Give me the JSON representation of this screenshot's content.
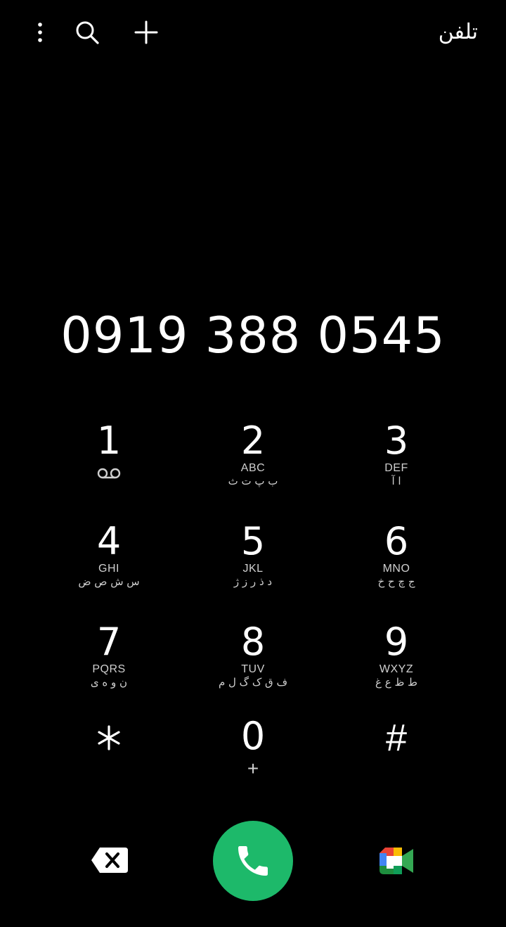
{
  "header": {
    "title": "تلفن",
    "icons": [
      "more-vert-icon",
      "search-icon",
      "add-icon"
    ]
  },
  "dialer": {
    "number": "0919 388 0545"
  },
  "keypad": {
    "keys": [
      {
        "digit": "1",
        "latin": "",
        "farsi": "",
        "extra_icon": "voicemail-icon"
      },
      {
        "digit": "2",
        "latin": "ABC",
        "farsi": "ب پ ت ث"
      },
      {
        "digit": "3",
        "latin": "DEF",
        "farsi": "ا آ"
      },
      {
        "digit": "4",
        "latin": "GHI",
        "farsi": "س ش ص ض"
      },
      {
        "digit": "5",
        "latin": "JKL",
        "farsi": "د ذ ر ز ژ"
      },
      {
        "digit": "6",
        "latin": "MNO",
        "farsi": "ج چ ح خ"
      },
      {
        "digit": "7",
        "latin": "PQRS",
        "farsi": "ن و ه ی"
      },
      {
        "digit": "8",
        "latin": "TUV",
        "farsi": "ف ق ک گ ل م"
      },
      {
        "digit": "9",
        "latin": "WXYZ",
        "farsi": "ط ظ ع غ"
      },
      {
        "digit": "*",
        "latin": "",
        "farsi": ""
      },
      {
        "digit": "0",
        "latin": "+",
        "farsi": ""
      },
      {
        "digit": "#",
        "latin": "",
        "farsi": ""
      }
    ]
  },
  "actions": {
    "backspace_icon": "backspace-icon",
    "call_icon": "phone-icon",
    "video_icon": "google-meet-icon",
    "call_color": "#1db96a"
  }
}
